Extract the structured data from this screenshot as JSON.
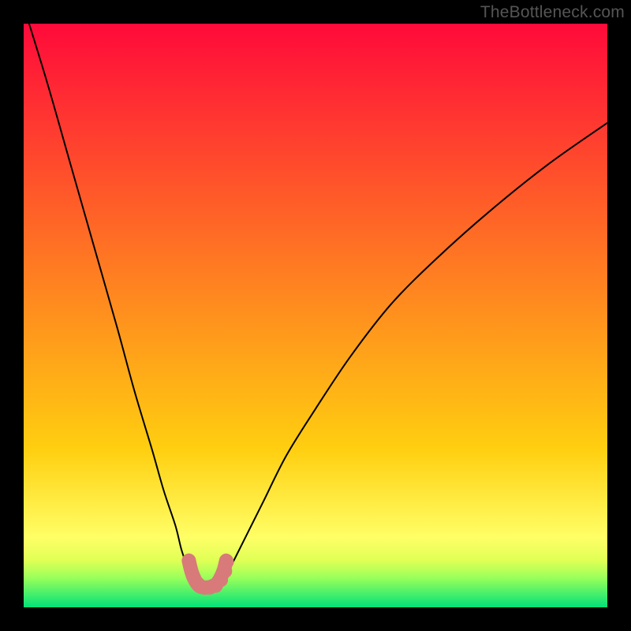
{
  "watermark": "TheBottleneck.com",
  "chart_data": {
    "type": "line",
    "title": "",
    "xlabel": "",
    "ylabel": "",
    "xlim": [
      0,
      100
    ],
    "ylim": [
      0,
      100
    ],
    "gradient_bands": [
      {
        "y0": 0,
        "y1": 73,
        "c0": "#ff0a3a",
        "c1": "#ffcf10"
      },
      {
        "y0": 73,
        "y1": 88,
        "c0": "#ffcf10",
        "c1": "#ffff66"
      },
      {
        "y0": 88,
        "y1": 92,
        "c0": "#ffff66",
        "c1": "#dfff55"
      },
      {
        "y0": 92,
        "y1": 95,
        "c0": "#dfff55",
        "c1": "#97ff5a"
      },
      {
        "y0": 95,
        "y1": 100,
        "c0": "#97ff5a",
        "c1": "#00e17a"
      }
    ],
    "series": [
      {
        "name": "curve-left",
        "x": [
          0,
          4,
          8,
          12,
          16,
          19,
          22,
          24,
          26,
          27,
          28,
          28.5,
          29
        ],
        "y": [
          -3,
          10,
          24,
          38,
          52,
          63,
          73,
          80,
          86,
          90,
          93,
          94.5,
          95.2
        ]
      },
      {
        "name": "curve-right",
        "x": [
          34,
          35,
          36,
          38,
          41,
          45,
          50,
          56,
          63,
          71,
          80,
          90,
          100
        ],
        "y": [
          95.2,
          94,
          92,
          88,
          82,
          74,
          66,
          57,
          48,
          40,
          32,
          24,
          17
        ]
      },
      {
        "name": "cup-fill-outline",
        "x": [
          28.3,
          28.8,
          29.5,
          30.2,
          31.0,
          32.0,
          33.0,
          33.7,
          34.3,
          34.7
        ],
        "y": [
          92.0,
          94.0,
          95.6,
          96.4,
          96.6,
          96.5,
          96.0,
          95.0,
          93.6,
          92.0
        ]
      }
    ],
    "cup_dots": {
      "x": [
        28.3,
        29.0,
        29.9,
        30.9,
        31.9,
        32.9,
        33.8,
        34.5,
        34.8
      ],
      "y": [
        92.0,
        94.6,
        96.0,
        96.6,
        96.6,
        96.3,
        95.3,
        93.8,
        92.2
      ]
    },
    "colors": {
      "curve": "#000000",
      "cup": "#d87a7a"
    }
  }
}
